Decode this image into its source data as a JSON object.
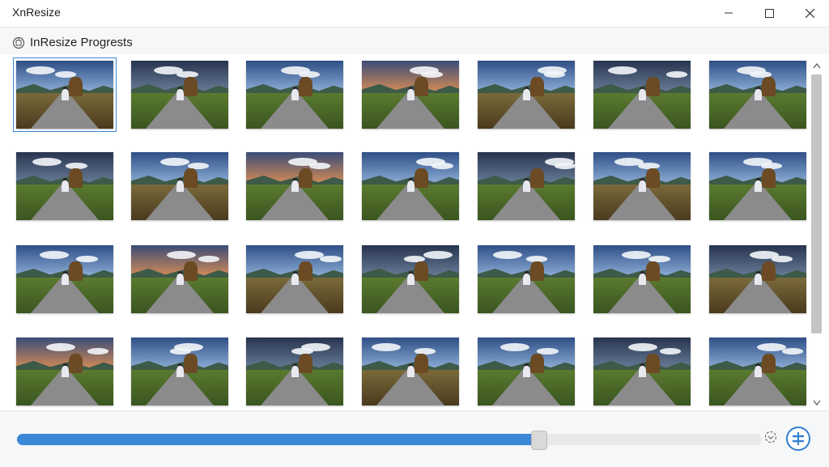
{
  "app": {
    "title": "XnResize"
  },
  "window_controls": {
    "minimize": "minimize-icon",
    "maximize": "maximize-icon",
    "close": "close-icon"
  },
  "header": {
    "label": "InResize Progrests",
    "icon": "drive-icon"
  },
  "grid": {
    "rows": 4,
    "columns": 7,
    "selected_index": 0,
    "item_description": "landscape-road-photo"
  },
  "progress": {
    "value": 0.7
  },
  "controls": {
    "spinner_icon": "spinner-icon",
    "action_icon": "equal-circle-icon"
  },
  "colors": {
    "accent": "#3b87d8",
    "selection": "#3a86d6"
  }
}
